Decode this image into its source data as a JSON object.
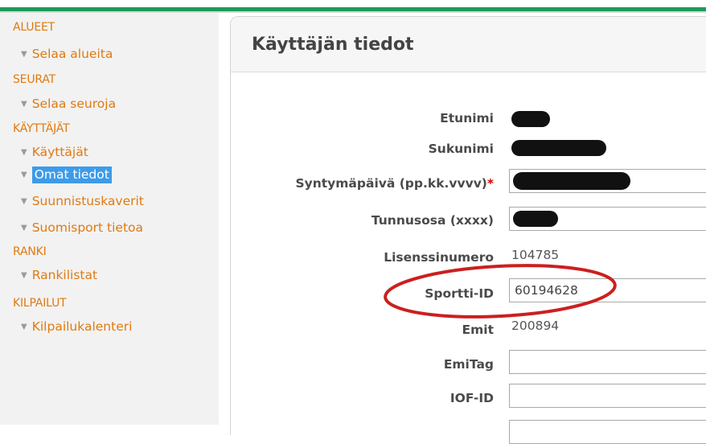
{
  "sidebar": {
    "sections": [
      {
        "label": "ALUEET",
        "items": [
          {
            "label": "Selaa alueita",
            "active": false
          }
        ]
      },
      {
        "label": "SEURAT",
        "items": [
          {
            "label": "Selaa seuroja",
            "active": false
          }
        ]
      },
      {
        "label": "KÄYTTÄJÄT",
        "items": [
          {
            "label": "Käyttäjät",
            "active": false
          },
          {
            "label": "Omat tiedot",
            "active": true
          },
          {
            "label": "Suunnistuskaverit",
            "active": false
          },
          {
            "label": "Suomisport tietoa",
            "active": false
          }
        ]
      },
      {
        "label": "RANKI",
        "items": [
          {
            "label": "Rankilistat",
            "active": false
          }
        ]
      },
      {
        "label": "KILPAILUT",
        "items": [
          {
            "label": "Kilpailukalenteri",
            "active": false
          }
        ]
      }
    ]
  },
  "main": {
    "title": "Käyttäjän tiedot",
    "fields": {
      "etunimi_label": "Etunimi",
      "sukunimi_label": "Sukunimi",
      "syntymapaiva_label": "Syntymäpäivä (pp.kk.vvvv)",
      "syntymapaiva_required": "*",
      "tunnusosa_label": "Tunnusosa (xxxx)",
      "lisenssinumero_label": "Lisenssinumero",
      "lisenssinumero_value": "104785",
      "sportti_label": "Sportti-ID",
      "sportti_value": "60194628",
      "emit_label": "Emit",
      "emit_value": "200894",
      "emitag_label": "EmiTag",
      "emitag_value": "",
      "iof_label": "IOF-ID",
      "iof_value": ""
    }
  },
  "colors": {
    "accent_green": "#1e9b57",
    "nav_orange": "#e07a10",
    "active_blue": "#3d9be9",
    "annotation_red": "#cc1f1f"
  }
}
